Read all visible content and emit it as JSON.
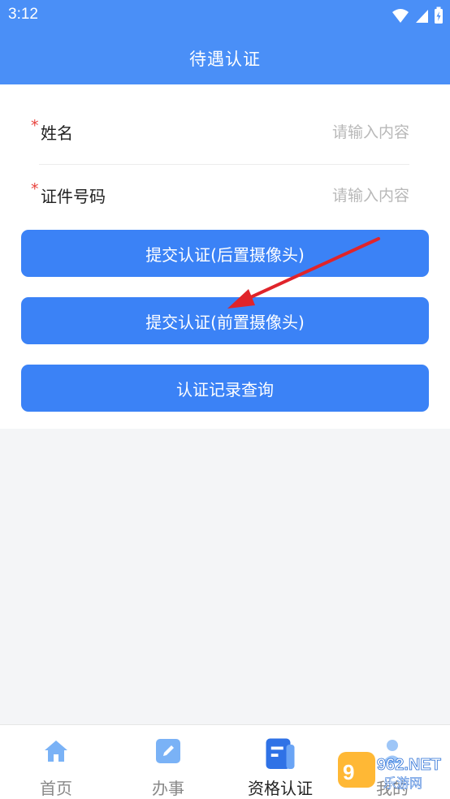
{
  "status_bar": {
    "time": "3:12"
  },
  "header": {
    "title": "待遇认证"
  },
  "form": {
    "fields": [
      {
        "required_mark": "*",
        "label": "姓名",
        "placeholder": "请输入内容"
      },
      {
        "required_mark": "*",
        "label": "证件号码",
        "placeholder": "请输入内容"
      }
    ],
    "buttons": [
      {
        "label": "提交认证(后置摄像头)"
      },
      {
        "label": "提交认证(前置摄像头)"
      },
      {
        "label": "认证记录查询"
      }
    ]
  },
  "tabbar": {
    "items": [
      {
        "label": "首页",
        "icon": "home-icon"
      },
      {
        "label": "办事",
        "icon": "edit-icon"
      },
      {
        "label": "资格认证",
        "icon": "document-icon"
      },
      {
        "label": "我的",
        "icon": "user-icon"
      }
    ],
    "active_index": 2
  },
  "watermark": {
    "text": "962.NET",
    "subtext": "乐游网"
  },
  "colors": {
    "primary": "#3b82f6",
    "header": "#4a8ff7",
    "required": "#e8423c",
    "annotation_arrow": "#e0242a"
  }
}
